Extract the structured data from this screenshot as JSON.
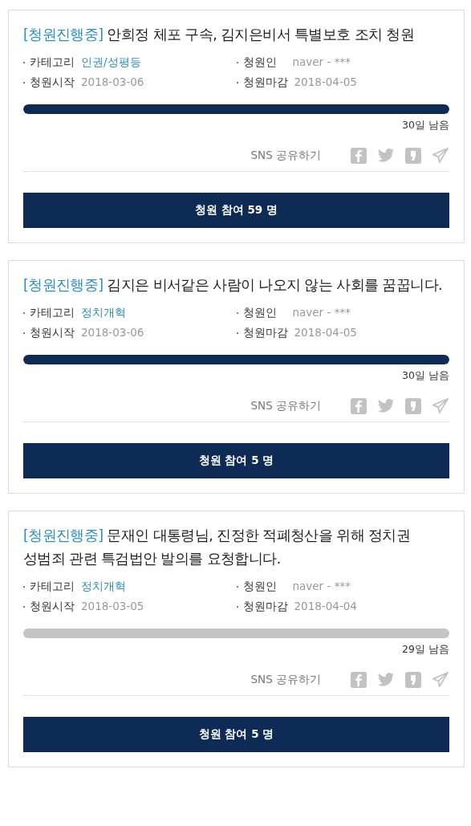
{
  "petitions": [
    {
      "status": "[청원진행중]",
      "title": "안희정 체포 구속, 김지은비서 특별보호 조치 청원",
      "category_label": "카테고리",
      "category": "인권/성평등",
      "petitioner_label": "청원인",
      "petitioner": "naver - ***",
      "start_label": "청원시작",
      "start_date": "2018-03-06",
      "end_label": "청원마감",
      "end_date": "2018-04-05",
      "level": 1,
      "remaining": "30일 남음",
      "share_label": "SNS 공유하기",
      "button": "청원 참여 59 명"
    },
    {
      "status": "[청원진행중]",
      "title": "김지은 비서같은 사람이 나오지 않는 사회를 꿈꿉니다.",
      "category_label": "카테고리",
      "category": "정치개혁",
      "petitioner_label": "청원인",
      "petitioner": "naver - ***",
      "start_label": "청원시작",
      "start_date": "2018-03-06",
      "end_label": "청원마감",
      "end_date": "2018-04-05",
      "level": 1,
      "remaining": "30일 남음",
      "share_label": "SNS 공유하기",
      "button": "청원 참여 5 명"
    },
    {
      "status": "[청원진행중]",
      "title": "문재인 대통령님, 진정한 적폐청산을 위해 정치권 성범죄 관련 특검법안 발의를 요청합니다.",
      "category_label": "카테고리",
      "category": "정치개혁",
      "petitioner_label": "청원인",
      "petitioner": "naver - ***",
      "start_label": "청원시작",
      "start_date": "2018-03-05",
      "end_label": "청원마감",
      "end_date": "2018-04-04",
      "level": 0,
      "remaining": "29일 남음",
      "share_label": "SNS 공유하기",
      "button": "청원 참여 5 명"
    }
  ]
}
